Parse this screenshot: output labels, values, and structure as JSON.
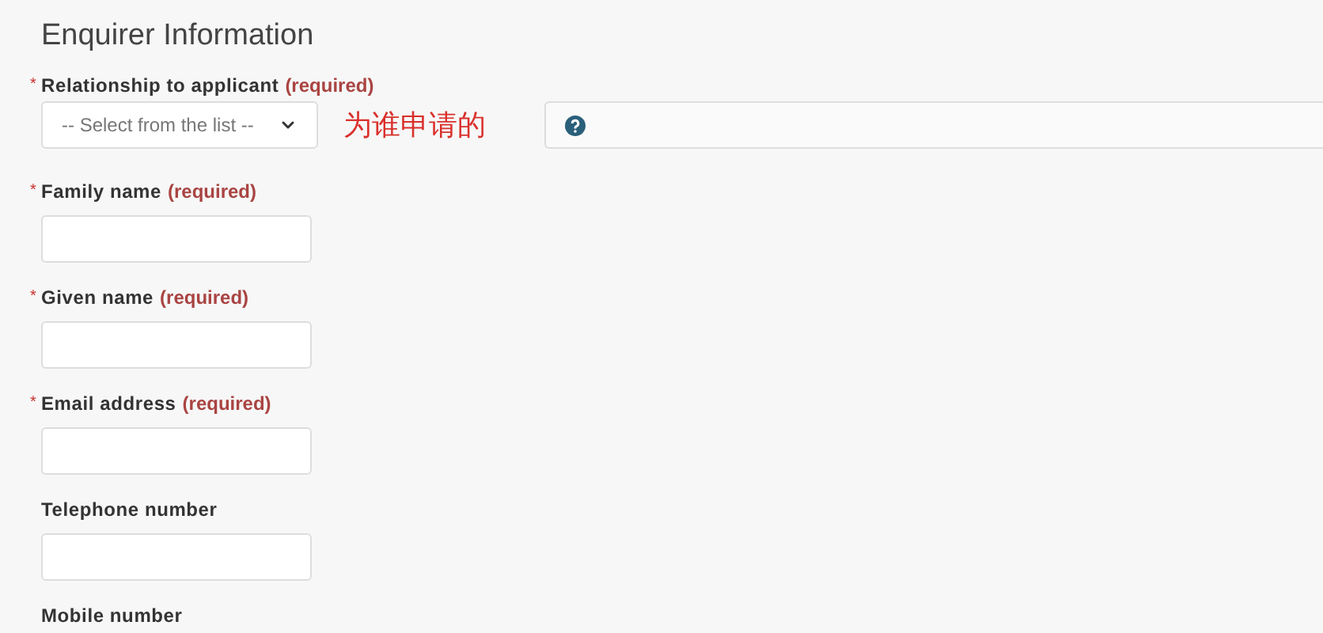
{
  "heading": "Enquirer Information",
  "fields": [
    {
      "kind": "select",
      "marker": "*",
      "label": "Relationship to applicant",
      "note": "(required)",
      "placeholder": "-- Select from the list --",
      "annotation": "为谁申请的",
      "help": true
    },
    {
      "kind": "text",
      "marker": "*",
      "label": "Family name",
      "note": "(required)"
    },
    {
      "kind": "text",
      "marker": "*",
      "label": "Given name",
      "note": "(required)"
    },
    {
      "kind": "text",
      "marker": "*",
      "label": "Email address",
      "note": "(required)"
    },
    {
      "kind": "text",
      "label": "Telephone number"
    },
    {
      "kind": "label",
      "label": "Mobile number"
    }
  ]
}
